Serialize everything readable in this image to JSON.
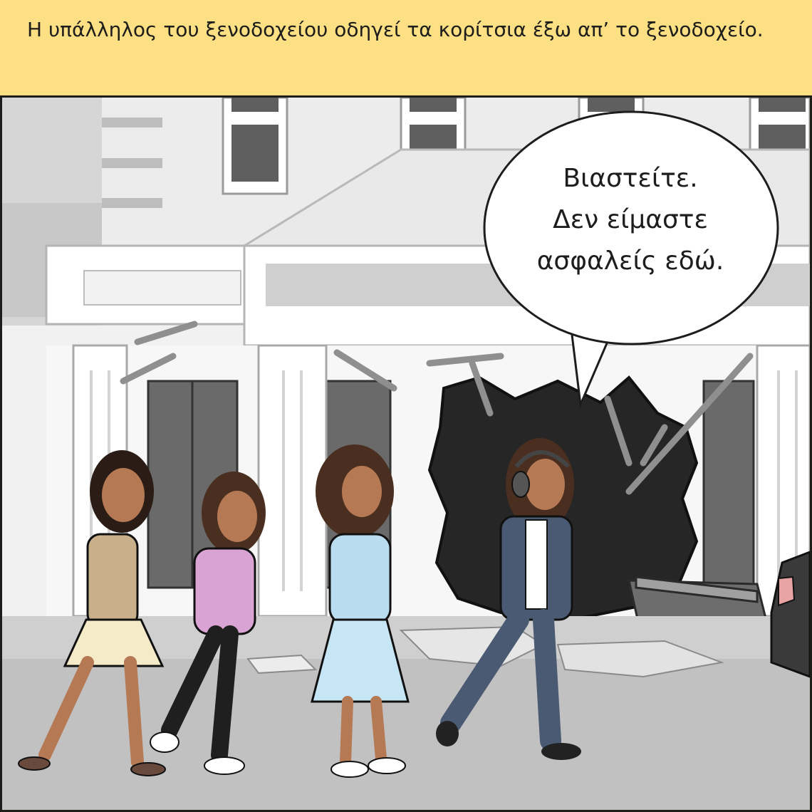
{
  "caption": {
    "text": "Η υπάλληλος του ξενοδοχείου οδηγεί τα κορίτσια έξω απ’ το ξενοδοχείο."
  },
  "speech_bubble": {
    "lines": [
      "Βιαστείτε.",
      "Δεν είμαστε",
      "ασφαλείς εδώ."
    ]
  }
}
